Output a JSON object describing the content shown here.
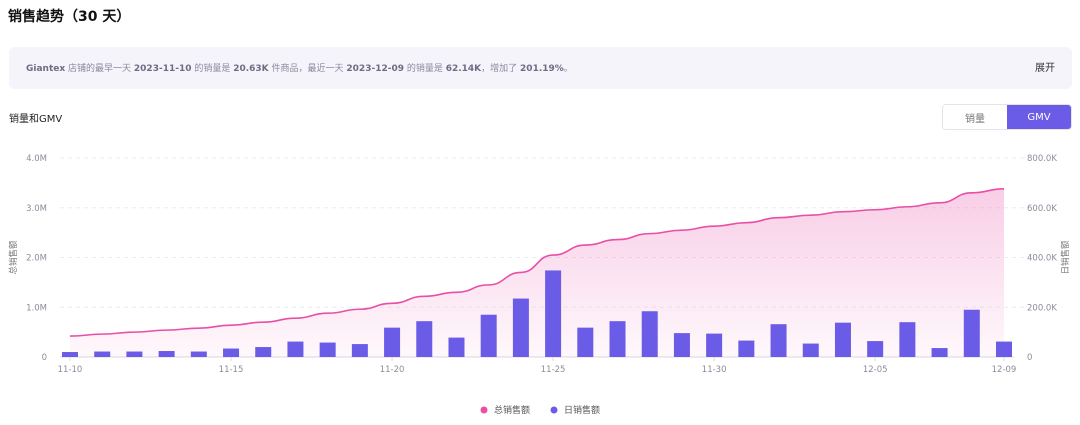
{
  "page": {
    "title": "销售趋势（30 天）",
    "banner": {
      "shop": "Giantex",
      "t1": " 店铺的最早一天 ",
      "start_date": "2023-11-10",
      "t2": " 的销量是 ",
      "start_sales": "20.63K",
      "t3": " 件商品，最近一天 ",
      "end_date": "2023-12-09",
      "t4": " 的销量是 ",
      "end_sales": "62.14K",
      "t5": "，增加了 ",
      "growth": "201.19%",
      "t6": "。"
    },
    "expand_label": "展开",
    "subtitle": "销量和GMV",
    "toggle": {
      "options": [
        "销量",
        "GMV"
      ],
      "active": "GMV"
    },
    "colors": {
      "bar": "#6b5ce7",
      "line": "#e84fa6",
      "toggle_active": "#6b5ce7"
    }
  },
  "chart_data": {
    "type": "bar",
    "x": [
      "11-10",
      "11-11",
      "11-12",
      "11-13",
      "11-14",
      "11-15",
      "11-16",
      "11-17",
      "11-18",
      "11-19",
      "11-20",
      "11-21",
      "11-22",
      "11-23",
      "11-24",
      "11-25",
      "11-26",
      "11-27",
      "11-28",
      "11-29",
      "11-30",
      "12-01",
      "12-02",
      "12-03",
      "12-04",
      "12-05",
      "12-06",
      "12-07",
      "12-08",
      "12-09"
    ],
    "x_ticks": [
      "11-10",
      "11-15",
      "11-20",
      "11-25",
      "11-30",
      "12-05",
      "12-09"
    ],
    "series": [
      {
        "name": "总销售额",
        "type": "area",
        "axis": "left",
        "color": "#e84fa6",
        "values": [
          0.42,
          0.46,
          0.5,
          0.54,
          0.58,
          0.64,
          0.7,
          0.78,
          0.88,
          0.96,
          1.08,
          1.22,
          1.3,
          1.45,
          1.7,
          2.05,
          2.25,
          2.36,
          2.48,
          2.55,
          2.63,
          2.7,
          2.8,
          2.85,
          2.92,
          2.96,
          3.02,
          3.1,
          3.3,
          3.38
        ]
      },
      {
        "name": "日销售额",
        "type": "bar",
        "axis": "right",
        "color": "#6b5ce7",
        "values": [
          20,
          22,
          22,
          24,
          22,
          34,
          40,
          62,
          58,
          52,
          118,
          144,
          78,
          170,
          235,
          348,
          118,
          144,
          184,
          96,
          94,
          66,
          132,
          54,
          138,
          64,
          140,
          36,
          190,
          62
        ]
      }
    ],
    "y_left": {
      "label": "总销售额",
      "ticks": [
        "0",
        "1.0M",
        "2.0M",
        "3.0M",
        "4.0M"
      ],
      "range": [
        0,
        4.0
      ],
      "unit": "M"
    },
    "y_right": {
      "label": "日销售额",
      "ticks": [
        "0",
        "200.0K",
        "400.0K",
        "600.0K",
        "800.0K"
      ],
      "range": [
        0,
        800
      ],
      "unit": "K"
    },
    "legend": [
      "总销售额",
      "日销售额"
    ],
    "grid": true,
    "legend_position": "bottom"
  }
}
